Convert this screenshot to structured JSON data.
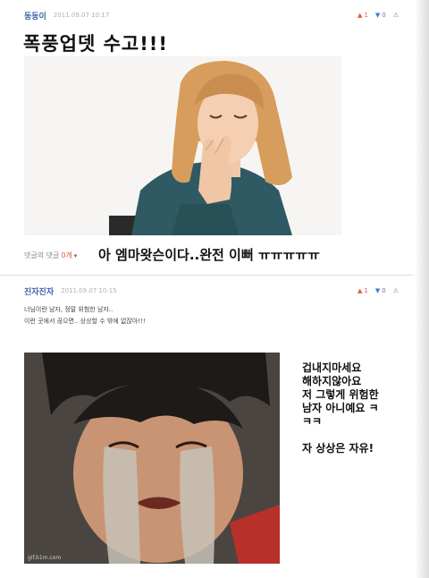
{
  "post1": {
    "author": "동동이",
    "date": "2011.09.07 10:17",
    "up": "1",
    "down": "0",
    "title": "폭풍업뎃 수고!!!"
  },
  "reply_bar": {
    "label": "댓글의 댓글",
    "count": "0개",
    "caret": "▾",
    "big_comment": "아 엠마왓슨이다..완전 이뻐 ㅠㅠㅠㅠㅠ"
  },
  "post2": {
    "author": "진자진자",
    "date": "2011.09.07 10:15",
    "up": "1",
    "down": "0",
    "line1": "너님이란 남자, 정말 위험한 남자..",
    "line2": "이런 곳에서 끊으면.. 상상할 수 밖에 없잖아!!!",
    "side_lines": [
      "겁내지마세요",
      "해하지않아요",
      "저 그렇게 위험한",
      "남자 아니예요 ㅋ",
      "ㅋㅋ",
      "",
      "자 상상은 자유!"
    ],
    "watermark": "gif.b1m.com"
  },
  "icons": {
    "thumb_up": "thumb-up-icon",
    "thumb_down": "thumb-down-icon",
    "alert": "siren-icon"
  },
  "colors": {
    "author": "#3a63a8",
    "up": "#e05a3a",
    "down": "#3a7bd5"
  }
}
